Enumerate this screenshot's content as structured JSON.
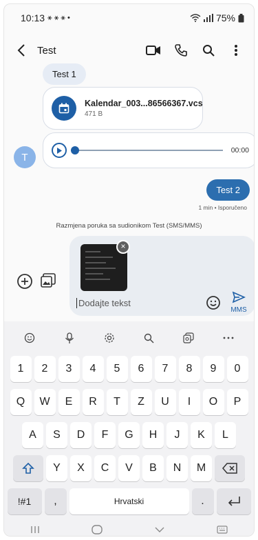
{
  "status": {
    "time": "10:13",
    "left_icons": "⚹ ⚹ ⚹ •",
    "battery": "75%"
  },
  "appbar": {
    "title": "Test"
  },
  "messages": {
    "in_text": "Test 1",
    "file_name": "Kalendar_003...86566367.vcs",
    "file_size": "471 B",
    "audio_time": "00:00",
    "avatar_letter": "T",
    "out_text": "Test 2",
    "out_meta": "1 min • Isporučeno",
    "system": "Razmjena poruka sa sudionikom Test (SMS/MMS)"
  },
  "compose": {
    "placeholder": "Dodajte tekst",
    "send_label": "MMS",
    "remove_attachment": "×"
  },
  "keyboard": {
    "row_numbers": [
      "1",
      "2",
      "3",
      "4",
      "5",
      "6",
      "7",
      "8",
      "9",
      "0"
    ],
    "row_top": [
      "Q",
      "W",
      "E",
      "R",
      "T",
      "Z",
      "U",
      "I",
      "O",
      "P"
    ],
    "row_mid": [
      "A",
      "S",
      "D",
      "F",
      "G",
      "H",
      "J",
      "K",
      "L"
    ],
    "row_bot": [
      "Y",
      "X",
      "C",
      "V",
      "B",
      "N",
      "M"
    ],
    "symbols": "!#1",
    "comma": ",",
    "space": "Hrvatski",
    "period": "."
  },
  "accent": "#1e5fa6"
}
